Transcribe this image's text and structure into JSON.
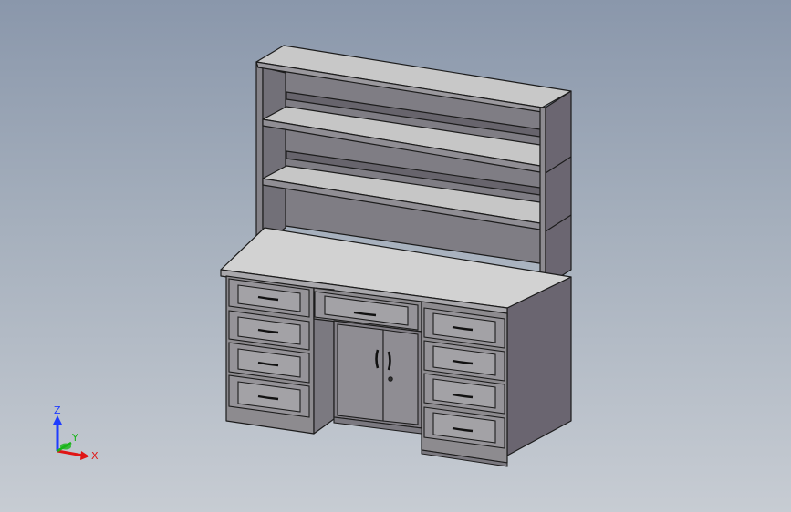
{
  "viewport": {
    "background_top": "#8a97ab",
    "background_bottom": "#c7ccd3"
  },
  "model": {
    "description_icon": "desk-hutch-cad-model",
    "colors": {
      "face": "#8d8b8f",
      "shelf_top": "#c9c9c9",
      "desktop_top": "#d2d2d2",
      "side_dark": "#6a6570",
      "edge": "#1c1c1c",
      "drawer_face": "#959398",
      "inset": "#a3a2a6"
    }
  },
  "triad": {
    "z_label": "Z",
    "y_label": "Y",
    "x_label": "X",
    "z_color": "#1f3cff",
    "y_color": "#19b519",
    "x_color": "#e01515"
  }
}
